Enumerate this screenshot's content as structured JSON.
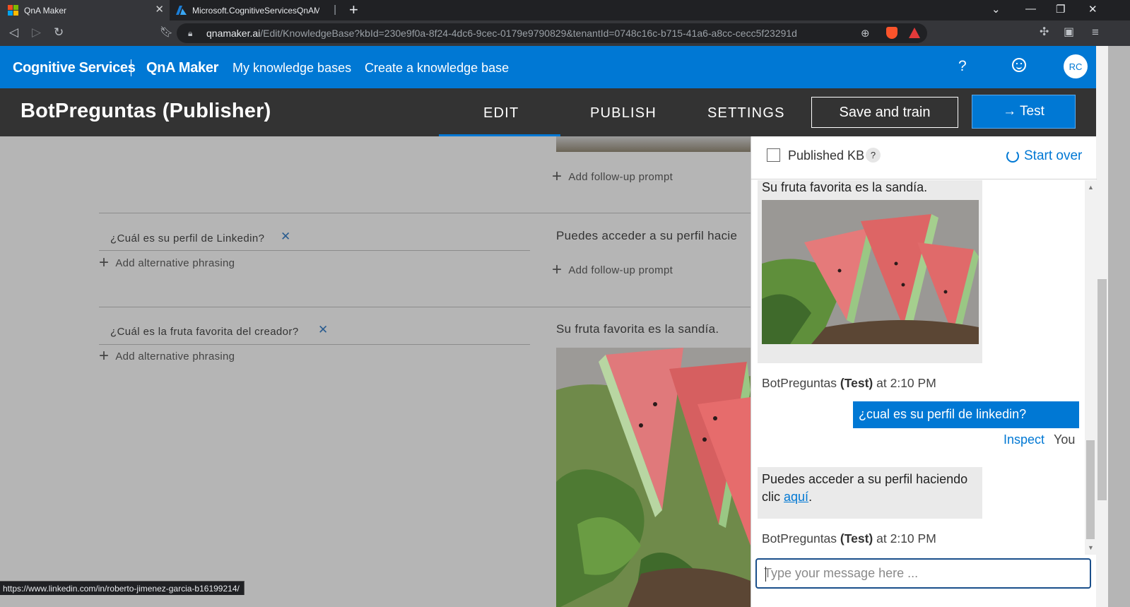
{
  "browser": {
    "tabs": [
      {
        "title": "QnA Maker",
        "active": true
      },
      {
        "title": "Microsoft.CognitiveServicesQnAMaker",
        "active": false
      }
    ],
    "url_host": "qnamaker.ai",
    "url_path": "/Edit/KnowledgeBase?kbId=230e9f0a-8f24-4dc6-9cec-0179e9790829&tenantId=0748c16c-b715-41a6-a8cc-cecc5f23291d",
    "status_url": "https://www.linkedin.com/in/roberto-jimenez-garcia-b16199214/"
  },
  "header": {
    "brand": "Cognitive Services",
    "product": "QnA Maker",
    "links": [
      "My knowledge bases",
      "Create a knowledge base"
    ],
    "help": "?",
    "avatar": "RC"
  },
  "kb": {
    "title": "BotPreguntas (Publisher)",
    "tabs": [
      "EDIT",
      "PUBLISH",
      "SETTINGS"
    ],
    "active_tab": "EDIT",
    "save_label": "Save and train",
    "test_label": "→ Test"
  },
  "qna": [
    {
      "question": "¿Cuál es su perfil de Linkedin?",
      "answer": "Puedes acceder a su perfil hacie",
      "add_alt": "Add alternative phrasing",
      "add_followup": "Add follow-up prompt"
    },
    {
      "question": "¿Cuál es la fruta favorita del creador?",
      "answer": "Su fruta favorita es la sandía.",
      "add_alt": "Add alternative phrasing"
    }
  ],
  "top_followup": "Add follow-up prompt",
  "test_panel": {
    "published_label": "Published KB",
    "help": "?",
    "start_over": "Start over",
    "messages": {
      "bot1_text": "Su fruta favorita es la sandía.",
      "bot1_meta_name": "BotPreguntas",
      "bot1_meta_tag": "(Test)",
      "bot1_meta_time": "at 2:10 PM",
      "user_text": "¿cual es su perfil de linkedin?",
      "inspect": "Inspect",
      "you": "You",
      "bot2_text": "Puedes acceder a su perfil haciendo clic",
      "bot2_link": "aquí",
      "bot2_tail": ".",
      "bot2_meta_name": "BotPreguntas",
      "bot2_meta_tag": "(Test)",
      "bot2_meta_time": "at 2:10 PM"
    },
    "input_placeholder": "Type your message here ..."
  }
}
